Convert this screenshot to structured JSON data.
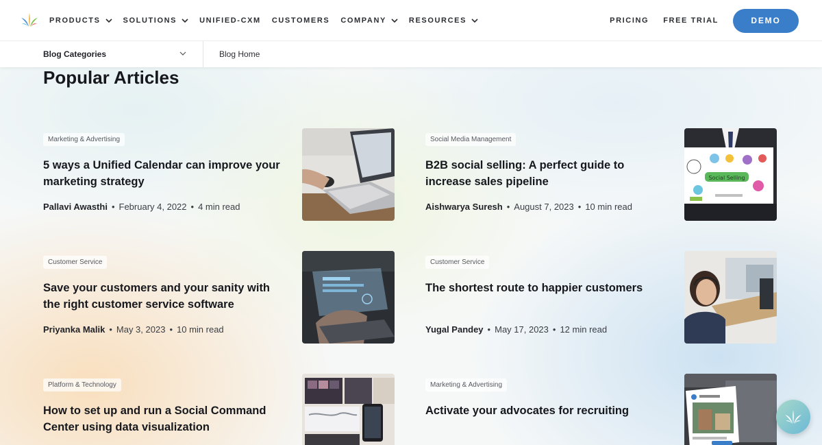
{
  "nav": {
    "items": [
      {
        "label": "PRODUCTS",
        "has_menu": true
      },
      {
        "label": "SOLUTIONS",
        "has_menu": true
      },
      {
        "label": "UNIFIED-CXM",
        "has_menu": false
      },
      {
        "label": "CUSTOMERS",
        "has_menu": false
      },
      {
        "label": "COMPANY",
        "has_menu": true
      },
      {
        "label": "RESOURCES",
        "has_menu": true
      }
    ],
    "pricing": "PRICING",
    "free_trial": "FREE TRIAL",
    "demo": "DEMO",
    "accent_color": "#3a7dc8"
  },
  "subnav": {
    "categories_label": "Blog Categories",
    "home_label": "Blog Home"
  },
  "section_title": "Popular Articles",
  "articles": [
    {
      "tag": "Marketing & Advertising",
      "title": "5 ways a Unified Calendar can improve your marketing strategy",
      "author": "Pallavi Awasthi",
      "date": "February 4, 2022",
      "read": "4 min read",
      "image": "laptop-desk-photo"
    },
    {
      "tag": "Social Media Management",
      "title": "B2B social selling: A perfect guide to increase sales pipeline",
      "author": "Aishwarya Suresh",
      "date": "August 7, 2023",
      "read": "10 min read",
      "image": "social-selling-whiteboard-photo"
    },
    {
      "tag": "Customer Service",
      "title": "Save your customers and your sanity with the right customer service software",
      "author": "Priyanka Malik",
      "date": "May 3, 2023",
      "read": "10 min read",
      "image": "holographic-screen-photo"
    },
    {
      "tag": "Customer Service",
      "title": "The shortest route to happier customers",
      "author": "Yugal Pandey",
      "date": "May 17, 2023",
      "read": "12 min read",
      "image": "support-agent-headset-photo"
    },
    {
      "tag": "Platform & Technology",
      "title": "How to set up and run a Social Command Center using data visualization",
      "author": "",
      "date": "",
      "read": "",
      "image": "command-center-screens-photo"
    },
    {
      "tag": "Marketing & Advertising",
      "title": "Activate your advocates for recruiting",
      "author": "",
      "date": "",
      "read": "",
      "image": "laptop-social-post-photo"
    }
  ],
  "chat_widget": "chat-launcher-icon"
}
